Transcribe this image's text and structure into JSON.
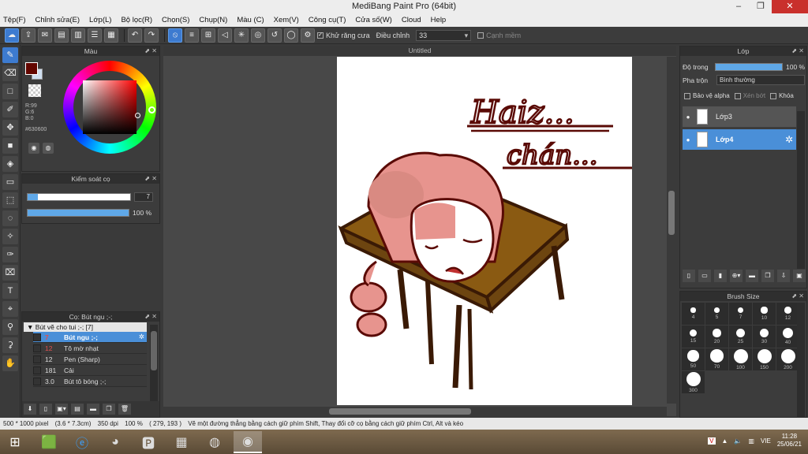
{
  "window": {
    "title": "MediBang Paint Pro (64bit)"
  },
  "menu": [
    "Tệp(F)",
    "Chỉnh sửa(E)",
    "Lớp(L)",
    "Bộ lọc(R)",
    "Chọn(S)",
    "Chụp(N)",
    "Màu (C)",
    "Xem(V)",
    "Công cụ(T)",
    "Cửa số(W)",
    "Cloud",
    "Help"
  ],
  "toolbar": {
    "antialias_label": "Khử răng cưa",
    "adjust_label": "Điều chỉnh",
    "adjust_value": "33",
    "edge_label": "Cạnh mềm"
  },
  "color_panel": {
    "title": "Màu",
    "r": "R:99",
    "g": "G:6",
    "b": "B:0",
    "hex": "#630600",
    "main_color": "#630600"
  },
  "brush_control": {
    "title": "Kiểm soát cọ",
    "size_value": "7",
    "opacity_value": "100 %",
    "size_fraction": 0.1,
    "opacity_fraction": 1.0
  },
  "brush_list": {
    "title": "Cọ: Bút ngu ;-;",
    "group": "Bút vẽ cho tui ;-; [7]",
    "items": [
      {
        "size": "7",
        "name": "Bút ngu ;-;",
        "selected": true
      },
      {
        "size": "12",
        "name": "Tô mờ nhạt",
        "selected": false
      },
      {
        "size": "12",
        "name": "Pen (Sharp)",
        "selected": false
      },
      {
        "size": "181",
        "name": "Cải",
        "selected": false
      },
      {
        "size": "3.0",
        "name": "Bút tô bóng ;-;",
        "selected": false
      }
    ]
  },
  "canvas": {
    "tab_title": "Untitled",
    "text_line1": "Haiz...",
    "text_line2": "chán..."
  },
  "layer_panel": {
    "title": "Lớp",
    "opacity_label": "Độ trong",
    "opacity_value": "100 %",
    "blend_label": "Pha trộn",
    "blend_value": "Bình thường",
    "protect_alpha": "Bảo vệ alpha",
    "clip": "Xén bớt",
    "lock": "Khóa",
    "layers": [
      {
        "name": "Lớp3",
        "selected": false
      },
      {
        "name": "Lớp4",
        "selected": true
      }
    ]
  },
  "brush_size_panel": {
    "title": "Brush Size",
    "sizes": [
      "4",
      "5",
      "7",
      "10",
      "12",
      "15",
      "20",
      "25",
      "30",
      "40",
      "50",
      "70",
      "100",
      "150",
      "200",
      "300"
    ]
  },
  "status": {
    "dimensions": "500 * 1000 pixel",
    "physical": "(3.6 * 7.3cm)",
    "dpi": "350 dpi",
    "zoom": "100 %",
    "coords": "( 279, 193 )",
    "hint": "Vẽ một đường thẳng bằng cách giữ phím Shift, Thay đổi cỡ cọ bằng cách giữ phím Ctrl, Alt và kéo"
  },
  "taskbar": {
    "lang": "VIE",
    "time": "11:28",
    "date": "25/06/21"
  }
}
